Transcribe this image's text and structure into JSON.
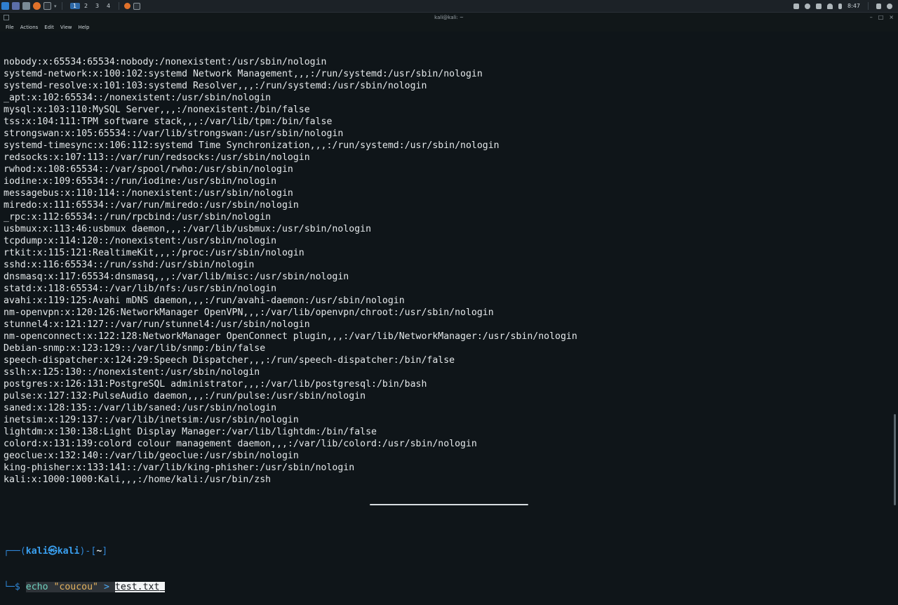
{
  "panel": {
    "workspaces": [
      "1",
      "2",
      "3",
      "4"
    ],
    "active_workspace": 0,
    "time": "8:47"
  },
  "window": {
    "title": "kali@kali: ~"
  },
  "menu": [
    "File",
    "Actions",
    "Edit",
    "View",
    "Help"
  ],
  "output_lines": [
    "nobody:x:65534:65534:nobody:/nonexistent:/usr/sbin/nologin",
    "systemd-network:x:100:102:systemd Network Management,,,:/run/systemd:/usr/sbin/nologin",
    "systemd-resolve:x:101:103:systemd Resolver,,,:/run/systemd:/usr/sbin/nologin",
    "_apt:x:102:65534::/nonexistent:/usr/sbin/nologin",
    "mysql:x:103:110:MySQL Server,,,:/nonexistent:/bin/false",
    "tss:x:104:111:TPM software stack,,,:/var/lib/tpm:/bin/false",
    "strongswan:x:105:65534::/var/lib/strongswan:/usr/sbin/nologin",
    "systemd-timesync:x:106:112:systemd Time Synchronization,,,:/run/systemd:/usr/sbin/nologin",
    "redsocks:x:107:113::/var/run/redsocks:/usr/sbin/nologin",
    "rwhod:x:108:65534::/var/spool/rwho:/usr/sbin/nologin",
    "iodine:x:109:65534::/run/iodine:/usr/sbin/nologin",
    "messagebus:x:110:114::/nonexistent:/usr/sbin/nologin",
    "miredo:x:111:65534::/var/run/miredo:/usr/sbin/nologin",
    "_rpc:x:112:65534::/run/rpcbind:/usr/sbin/nologin",
    "usbmux:x:113:46:usbmux daemon,,,:/var/lib/usbmux:/usr/sbin/nologin",
    "tcpdump:x:114:120::/nonexistent:/usr/sbin/nologin",
    "rtkit:x:115:121:RealtimeKit,,,:/proc:/usr/sbin/nologin",
    "sshd:x:116:65534::/run/sshd:/usr/sbin/nologin",
    "dnsmasq:x:117:65534:dnsmasq,,,:/var/lib/misc:/usr/sbin/nologin",
    "statd:x:118:65534::/var/lib/nfs:/usr/sbin/nologin",
    "avahi:x:119:125:Avahi mDNS daemon,,,:/run/avahi-daemon:/usr/sbin/nologin",
    "nm-openvpn:x:120:126:NetworkManager OpenVPN,,,:/var/lib/openvpn/chroot:/usr/sbin/nologin",
    "stunnel4:x:121:127::/var/run/stunnel4:/usr/sbin/nologin",
    "nm-openconnect:x:122:128:NetworkManager OpenConnect plugin,,,:/var/lib/NetworkManager:/usr/sbin/nologin",
    "Debian-snmp:x:123:129::/var/lib/snmp:/bin/false",
    "speech-dispatcher:x:124:29:Speech Dispatcher,,,:/run/speech-dispatcher:/bin/false",
    "sslh:x:125:130::/nonexistent:/usr/sbin/nologin",
    "postgres:x:126:131:PostgreSQL administrator,,,:/var/lib/postgresql:/bin/bash",
    "pulse:x:127:132:PulseAudio daemon,,,:/run/pulse:/usr/sbin/nologin",
    "saned:x:128:135::/var/lib/saned:/usr/sbin/nologin",
    "inetsim:x:129:137::/var/lib/inetsim:/usr/sbin/nologin",
    "lightdm:x:130:138:Light Display Manager:/var/lib/lightdm:/bin/false",
    "colord:x:131:139:colord colour management daemon,,,:/var/lib/colord:/usr/sbin/nologin",
    "geoclue:x:132:140::/var/lib/geoclue:/usr/sbin/nologin",
    "king-phisher:x:133:141::/var/lib/king-phisher:/usr/sbin/nologin",
    "kali:x:1000:1000:Kali,,,:/home/kali:/usr/bin/zsh"
  ],
  "prompt": {
    "line1_prefix": "┌──(",
    "user_host": "kali㉿kali",
    "line1_mid": ")-[",
    "cwd": "~",
    "line1_suffix": "]",
    "line2_prefix": "└─$ ",
    "command": "echo",
    "string_arg": "\"coucou\"",
    "redirect": ">",
    "file_arg": "test.txt"
  }
}
